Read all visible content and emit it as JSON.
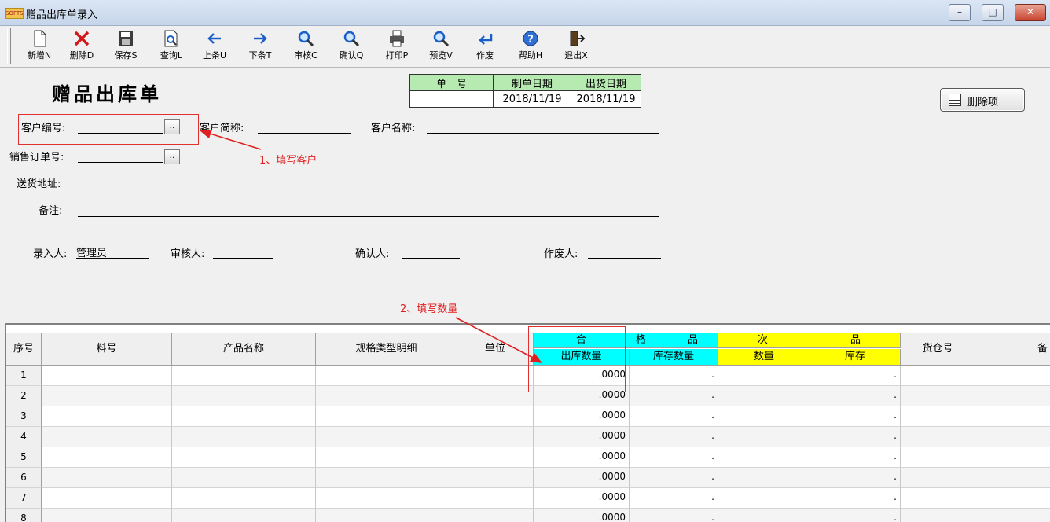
{
  "window": {
    "title": "赠品出库单录入",
    "app_icon_text": "SOFTSCAPE",
    "minimize": "–",
    "maximize": "□",
    "close": "✕"
  },
  "toolbar": [
    {
      "label": "新增N",
      "icon": "new-doc-icon"
    },
    {
      "label": "删除D",
      "icon": "delete-x-icon"
    },
    {
      "label": "保存S",
      "icon": "floppy-save-icon"
    },
    {
      "label": "查询L",
      "icon": "doc-search-icon"
    },
    {
      "label": "上条U",
      "icon": "arrow-left-icon"
    },
    {
      "label": "下条T",
      "icon": "arrow-right-icon"
    },
    {
      "label": "审核C",
      "icon": "magnifier-icon"
    },
    {
      "label": "确认Q",
      "icon": "magnifier-icon"
    },
    {
      "label": "打印P",
      "icon": "printer-icon"
    },
    {
      "label": "预览V",
      "icon": "magnifier-icon"
    },
    {
      "label": "作废",
      "icon": "return-arrow-icon"
    },
    {
      "label": "帮助H",
      "icon": "help-icon"
    },
    {
      "label": "退出X",
      "icon": "exit-door-icon"
    }
  ],
  "form": {
    "title": "赠品出库单",
    "doc_headers": [
      "单　号",
      "制单日期",
      "出货日期"
    ],
    "doc_values": [
      "",
      "2018/11/19",
      "2018/11/19"
    ],
    "delete_item_button": "删除项",
    "customer_code_label": "客户编号:",
    "customer_short_label": "客户简称:",
    "customer_name_label": "客户名称:",
    "sales_order_label": "销售订单号:",
    "address_label": "送货地址:",
    "remark_label": "备注:",
    "browse_button": "..",
    "entered_by_label": "录入人:",
    "entered_by_value": "管理员",
    "reviewer_label": "审核人:",
    "confirmer_label": "确认人:",
    "voider_label": "作废人:"
  },
  "annotations": {
    "step1": "1、填写客户",
    "step2": "2、填写数量"
  },
  "colors": {
    "cyan_header": "#00ffff",
    "yellow_header": "#ffff00",
    "annotation_red": "#e02020",
    "doc_header_green": "#b7eab1"
  },
  "grid": {
    "columns": {
      "seq": "序号",
      "item_no": "料号",
      "product_name": "产品名称",
      "spec": "规格类型明细",
      "unit": "单位",
      "group1_chars": [
        "合",
        "格",
        "品"
      ],
      "group2_chars": [
        "次",
        "品"
      ],
      "out_qty": "出库数量",
      "stock_qty": "库存数量",
      "defect_qty": "数量",
      "defect_stock": "库存",
      "warehouse": "货仓号",
      "more": "备"
    },
    "rows": [
      {
        "seq": "1",
        "out_qty": ".0000",
        "stock": "."
      },
      {
        "seq": "2",
        "out_qty": ".0000",
        "stock": "."
      },
      {
        "seq": "3",
        "out_qty": ".0000",
        "stock": "."
      },
      {
        "seq": "4",
        "out_qty": ".0000",
        "stock": "."
      },
      {
        "seq": "5",
        "out_qty": ".0000",
        "stock": "."
      },
      {
        "seq": "6",
        "out_qty": ".0000",
        "stock": "."
      },
      {
        "seq": "7",
        "out_qty": ".0000",
        "stock": "."
      },
      {
        "seq": "8",
        "out_qty": ".0000",
        "stock": "."
      }
    ]
  }
}
